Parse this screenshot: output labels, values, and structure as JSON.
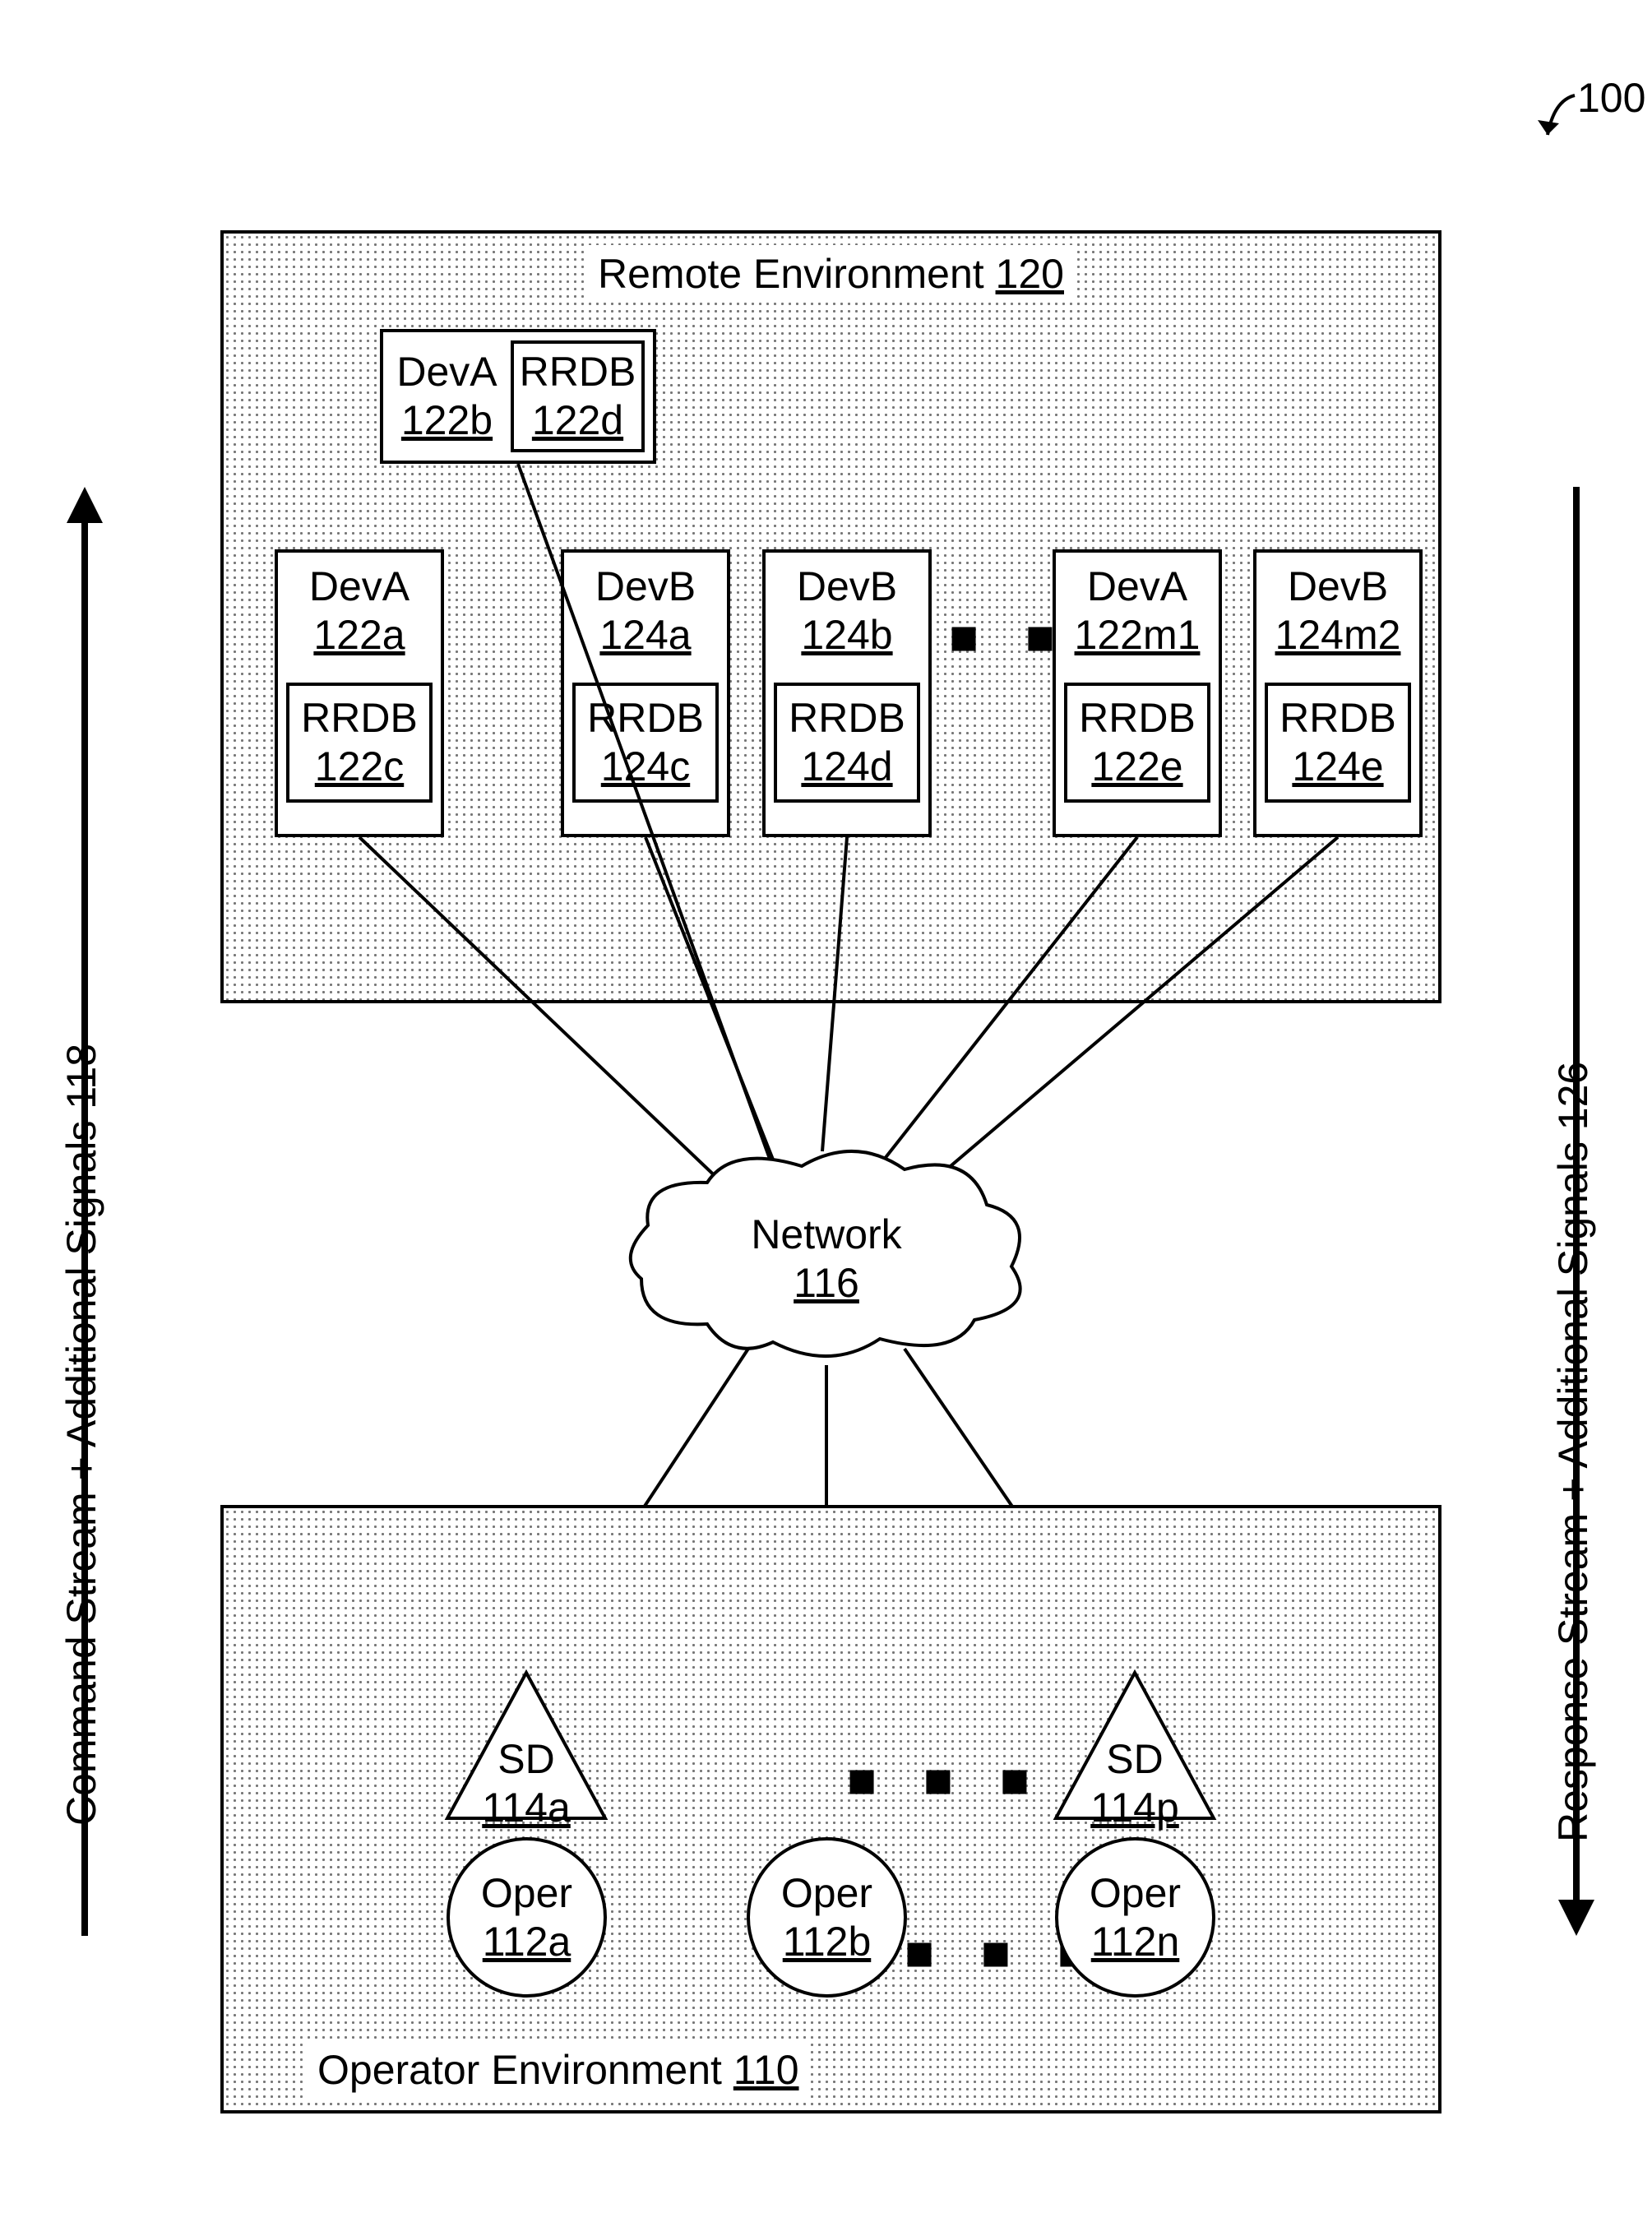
{
  "fig_ref": {
    "label": "100"
  },
  "remote": {
    "title_prefix": "Remote Environment ",
    "title_ref": "120",
    "top_pair": {
      "dev": {
        "name": "DevA",
        "ref": "122b"
      },
      "rrdb": {
        "name": "RRDB",
        "ref": "122d"
      }
    },
    "row": [
      {
        "dev": {
          "name": "DevA",
          "ref": "122a"
        },
        "rrdb": {
          "name": "RRDB",
          "ref": "122c"
        }
      },
      {
        "dev": {
          "name": "DevB",
          "ref": "124a"
        },
        "rrdb": {
          "name": "RRDB",
          "ref": "124c"
        }
      },
      {
        "dev": {
          "name": "DevB",
          "ref": "124b"
        },
        "rrdb": {
          "name": "RRDB",
          "ref": "124d"
        }
      },
      {
        "dev": {
          "name": "DevA",
          "ref": "122m1"
        },
        "rrdb": {
          "name": "RRDB",
          "ref": "122e"
        }
      },
      {
        "dev": {
          "name": "DevB",
          "ref": "124m2"
        },
        "rrdb": {
          "name": "RRDB",
          "ref": "124e"
        }
      }
    ]
  },
  "network": {
    "label": "Network",
    "ref": "116"
  },
  "operator": {
    "title_prefix": "Operator Environment ",
    "title_ref": "110",
    "sd": [
      {
        "name": "SD",
        "ref": "114a"
      },
      {
        "name": "SD",
        "ref": "114p"
      }
    ],
    "opers": [
      {
        "name": "Oper",
        "ref": "112a"
      },
      {
        "name": "Oper",
        "ref": "112b"
      },
      {
        "name": "Oper",
        "ref": "112n"
      }
    ]
  },
  "left_axis": {
    "text": "Command Stream + Additional Signals 118"
  },
  "right_axis": {
    "text": "Response Stream + Additional Signals 126"
  }
}
